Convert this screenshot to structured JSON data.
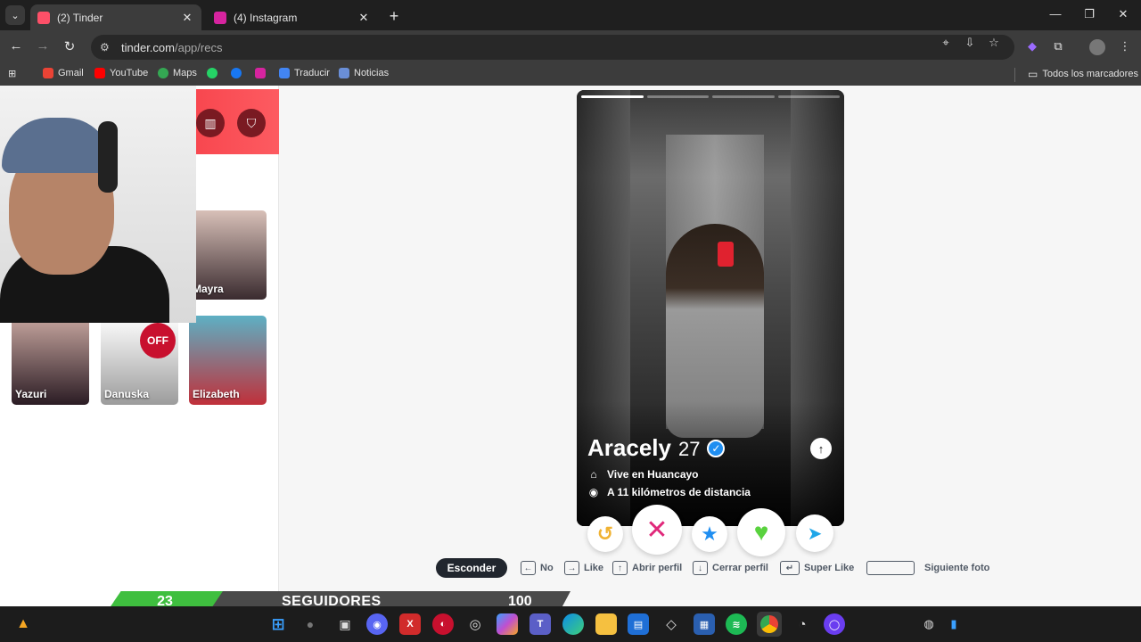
{
  "browser": {
    "tabs": [
      {
        "title": "(2) Tinder",
        "fav_color": "#fd5068",
        "active": true
      },
      {
        "title": "(4) Instagram",
        "fav_color": "#d6249f",
        "active": false
      }
    ],
    "url_host": "tinder.com",
    "url_path": "/app/recs",
    "bookmarks": [
      "Gmail",
      "YouTube",
      "Maps",
      "",
      "",
      "",
      "Traducir",
      "Noticias"
    ],
    "bookmarks_folder": "Todos los marcadores"
  },
  "matches": [
    {
      "name": "Mayra",
      "color_top": "#d8c0b8",
      "color_bottom": "#3a2b2f"
    },
    {
      "name": "Yazuri",
      "color_top": "#c8a7a0",
      "color_bottom": "#2b1c24"
    },
    {
      "name": "Danuska",
      "color_top": "#ffffff",
      "color_bottom": "#9c9c9c",
      "badge": "OFF"
    },
    {
      "name": "Elizabeth",
      "color_top": "#5db0c4",
      "color_bottom": "#c0303a"
    }
  ],
  "profile": {
    "name": "Aracely",
    "age": "27",
    "lives": "Vive en Huancayo",
    "distance": "A 11 kilómetros de distancia",
    "photo_count": 4,
    "photo_index": 0
  },
  "actions": [
    {
      "name": "rewind-button",
      "icon": "↺",
      "color": "#f0b232"
    },
    {
      "name": "nope-button",
      "icon": "✕",
      "color": "#e0287a"
    },
    {
      "name": "super-like-button",
      "icon": "★",
      "color": "#1f8ef1"
    },
    {
      "name": "like-button",
      "icon": "♥",
      "color": "#59d23e"
    },
    {
      "name": "boost-button",
      "icon": "➤",
      "color": "#1fa6e8"
    }
  ],
  "shortcuts": {
    "hide": "Esconder",
    "no": "No",
    "like": "Like",
    "open_profile": "Abrir perfil",
    "close_profile": "Cerrar perfil",
    "super_like": "Super Like",
    "next_photo": "Siguiente foto"
  },
  "overlay": {
    "count": "23",
    "label": "SEGUIDORES",
    "goal": "100"
  }
}
